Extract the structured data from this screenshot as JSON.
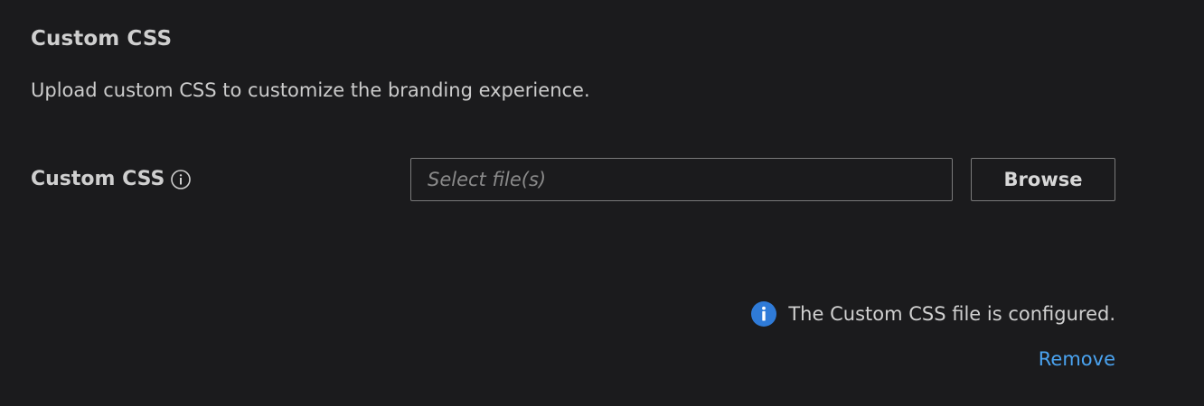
{
  "section": {
    "title": "Custom CSS",
    "description": "Upload custom CSS to customize the branding experience."
  },
  "field": {
    "label": "Custom CSS",
    "info_icon": "info-outline-icon",
    "input_placeholder": "Select file(s)",
    "input_value": "",
    "browse_label": "Browse"
  },
  "status": {
    "icon": "info-filled-icon",
    "icon_color": "#2f7bd8",
    "message": "The Custom CSS file is configured.",
    "remove_label": "Remove",
    "link_color": "#4aa3f0"
  }
}
